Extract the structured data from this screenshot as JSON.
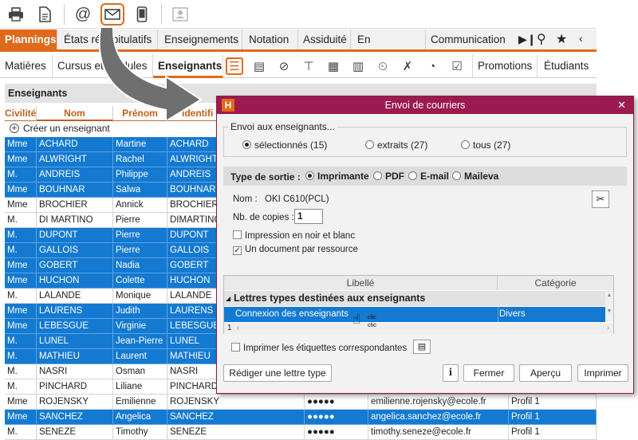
{
  "toolbar": {
    "icons": [
      "printer-icon",
      "document-icon",
      "at-icon",
      "mail-icon",
      "phone-icon",
      "contact-card-icon"
    ]
  },
  "nav": {
    "items": [
      "Plannings",
      "États récapitulatifs",
      "Enseignements",
      "Notation",
      "Assiduité",
      "En entreprise",
      "Communication"
    ]
  },
  "subnav": {
    "items": [
      "Matières",
      "Cursus et modules",
      "Enseignants",
      "Promotions",
      "Étudiants"
    ]
  },
  "list": {
    "title": "Enseignants",
    "columns": [
      "Civilité",
      "Nom",
      "Prénom",
      "Identifi"
    ],
    "create_label": "Créer un enseignant",
    "rows": [
      {
        "civ": "Mme",
        "nom": "ACHARD",
        "prenom": "Martine",
        "ident": "ACHARD",
        "pwd": "",
        "email": "",
        "profil": "",
        "sel": true
      },
      {
        "civ": "Mme",
        "nom": "ALWRIGHT",
        "prenom": "Rachel",
        "ident": "ALWRIGHT",
        "pwd": "",
        "email": "",
        "profil": "",
        "sel": true
      },
      {
        "civ": "M.",
        "nom": "ANDREIS",
        "prenom": "Philippe",
        "ident": "ANDREIS",
        "pwd": "",
        "email": "",
        "profil": "",
        "sel": true
      },
      {
        "civ": "Mme",
        "nom": "BOUHNAR",
        "prenom": "Salwa",
        "ident": "BOUHNAR",
        "pwd": "",
        "email": "",
        "profil": "",
        "sel": true
      },
      {
        "civ": "Mme",
        "nom": "BROCHIER",
        "prenom": "Annick",
        "ident": "BROCHIER",
        "pwd": "",
        "email": "",
        "profil": "",
        "sel": false
      },
      {
        "civ": "M.",
        "nom": "DI MARTINO",
        "prenom": "Pierre",
        "ident": "DIMARTINO",
        "pwd": "",
        "email": "",
        "profil": "",
        "sel": false
      },
      {
        "civ": "M.",
        "nom": "DUPONT",
        "prenom": "Pierre",
        "ident": "DUPONT",
        "pwd": "",
        "email": "",
        "profil": "",
        "sel": true
      },
      {
        "civ": "M.",
        "nom": "GALLOIS",
        "prenom": "Pierre",
        "ident": "GALLOIS",
        "pwd": "",
        "email": "",
        "profil": "",
        "sel": true
      },
      {
        "civ": "Mme",
        "nom": "GOBERT",
        "prenom": "Nadia",
        "ident": "GOBERT",
        "pwd": "",
        "email": "",
        "profil": "",
        "sel": true
      },
      {
        "civ": "Mme",
        "nom": "HUCHON",
        "prenom": "Colette",
        "ident": "HUCHON",
        "pwd": "",
        "email": "",
        "profil": "",
        "sel": true
      },
      {
        "civ": "M.",
        "nom": "LALANDE",
        "prenom": "Monique",
        "ident": "LALANDE",
        "pwd": "",
        "email": "",
        "profil": "",
        "sel": false
      },
      {
        "civ": "Mme",
        "nom": "LAURENS",
        "prenom": "Judith",
        "ident": "LAURENS",
        "pwd": "",
        "email": "",
        "profil": "",
        "sel": true
      },
      {
        "civ": "Mme",
        "nom": "LEBESGUE",
        "prenom": "Virginie",
        "ident": "LEBESGUE",
        "pwd": "",
        "email": "",
        "profil": "",
        "sel": true
      },
      {
        "civ": "M.",
        "nom": "LUNEL",
        "prenom": "Jean-Pierre",
        "ident": "LUNEL",
        "pwd": "",
        "email": "",
        "profil": "",
        "sel": true
      },
      {
        "civ": "M.",
        "nom": "MATHIEU",
        "prenom": "Laurent",
        "ident": "MATHIEU",
        "pwd": "",
        "email": "",
        "profil": "",
        "sel": true
      },
      {
        "civ": "M.",
        "nom": "NASRI",
        "prenom": "Osman",
        "ident": "NASRI",
        "pwd": "",
        "email": "",
        "profil": "",
        "sel": false
      },
      {
        "civ": "M.",
        "nom": "PINCHARD",
        "prenom": "Liliane",
        "ident": "PINCHARD",
        "pwd": "",
        "email": "",
        "profil": "",
        "sel": false
      },
      {
        "civ": "Mme",
        "nom": "ROJENSKY",
        "prenom": "Emilienne",
        "ident": "ROJENSKY",
        "pwd": "●●●●●",
        "email": "emilienne.rojensky@ecole.fr",
        "profil": "Profil 1",
        "sel": false
      },
      {
        "civ": "Mme",
        "nom": "SANCHEZ",
        "prenom": "Angelica",
        "ident": "SANCHEZ",
        "pwd": "●●●●●",
        "email": "angelica.sanchez@ecole.fr",
        "profil": "Profil 1",
        "sel": true
      },
      {
        "civ": "M.",
        "nom": "SENEZE",
        "prenom": "Timothy",
        "ident": "SENEZE",
        "pwd": "●●●●●",
        "email": "timothy.seneze@ecole.fr",
        "profil": "Profil 1",
        "sel": false
      }
    ]
  },
  "dialog": {
    "logo": "H",
    "title": "Envoi de courriers",
    "close": "✕",
    "send_group": "Envoi aux enseignants...",
    "send_opts": [
      {
        "label": "sélectionnés (15)",
        "on": true
      },
      {
        "label": "extraits (27)",
        "on": false
      },
      {
        "label": "tous (27)",
        "on": false
      }
    ],
    "output_label": "Type de sortie :",
    "output_opts": [
      {
        "label": "Imprimante",
        "on": true
      },
      {
        "label": "PDF",
        "on": false
      },
      {
        "label": "E-mail",
        "on": false
      },
      {
        "label": "Maileva",
        "on": false
      }
    ],
    "printer_label": "Nom :",
    "printer_value": "OKI C610(PCL)",
    "copies_label": "Nb. de copies :",
    "copies_value": "1",
    "bw_label": "Impression en noir et blanc",
    "bw_checked": false,
    "onedoc_label": "Un document par ressource",
    "onedoc_checked": true,
    "table": {
      "col_libelle": "Libellé",
      "col_categorie": "Catégorie",
      "group": "Lettres types destinées aux enseignants",
      "row_libelle": "Connexion des enseignants",
      "row_categorie": "Divers",
      "counter": "1",
      "click1": "clic",
      "click2": "clic"
    },
    "labels_label": "Imprimer les étiquettes correspondantes",
    "labels_checked": false,
    "btn_write": "Rédiger une lettre type",
    "btn_info": "i",
    "btn_close": "Fermer",
    "btn_preview": "Aperçu",
    "btn_print": "Imprimer"
  },
  "colors": {
    "accent": "#e06a1b",
    "selection": "#1479d1",
    "dialog_title": "#9b1a4f"
  }
}
